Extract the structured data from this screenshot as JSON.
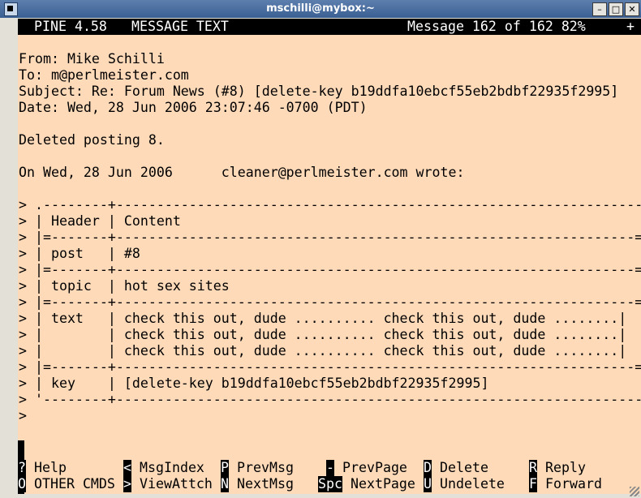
{
  "window": {
    "title": "mschilli@mybox:~",
    "min": "–",
    "max": "□",
    "close": "✕"
  },
  "header": {
    "app": "PINE 4.58",
    "screen": "MESSAGE TEXT",
    "status": "Message 162 of 162 82%",
    "flag": "+"
  },
  "message": {
    "lines": [
      "",
      "From: Mike Schilli",
      "To: m@perlmeister.com",
      "Subject: Re: Forum News (#8) [delete-key b19ddfa10ebcf55eb2bdbf22935f2995]",
      "Date: Wed, 28 Jun 2006 23:07:46 -0700 (PDT)",
      "",
      "Deleted posting 8.",
      "",
      "On Wed, 28 Jun 2006      cleaner@perlmeister.com wrote:",
      "",
      "> .--------+-----------------------------------------------------------------.",
      "> | Header | Content                                                         |",
      "> |=-------+----------------------------------------------------------------=|",
      "> | post   | #8                                                              |",
      "> |=-------+----------------------------------------------------------------=|",
      "> | topic  | hot sex sites                                                   |",
      "> |=-------+----------------------------------------------------------------=|",
      "> | text   | check this out, dude .......... check this out, dude ........|",
      "> |        | check this out, dude .......... check this out, dude ........|",
      "> |        | check this out, dude .......... check this out, dude ........|",
      "> |=-------+----------------------------------------------------------------=|",
      "> | key    | [delete-key b19ddfa10ebcf55eb2bdbf22935f2995]                   |",
      "> '--------+-----------------------------------------------------------------'",
      ">"
    ]
  },
  "menu": [
    {
      "key": "?",
      "label": "Help"
    },
    {
      "key": "O",
      "label": "OTHER CMDS"
    },
    {
      "key": "<",
      "label": "MsgIndex"
    },
    {
      "key": ">",
      "label": "ViewAttch"
    },
    {
      "key": "P",
      "label": "PrevMsg"
    },
    {
      "key": "N",
      "label": "NextMsg"
    },
    {
      "key": "-",
      "label": "PrevPage"
    },
    {
      "key": "Spc",
      "label": "NextPage"
    },
    {
      "key": "D",
      "label": "Delete"
    },
    {
      "key": "U",
      "label": "Undelete"
    },
    {
      "key": "R",
      "label": "Reply"
    },
    {
      "key": "F",
      "label": "Forward"
    }
  ]
}
